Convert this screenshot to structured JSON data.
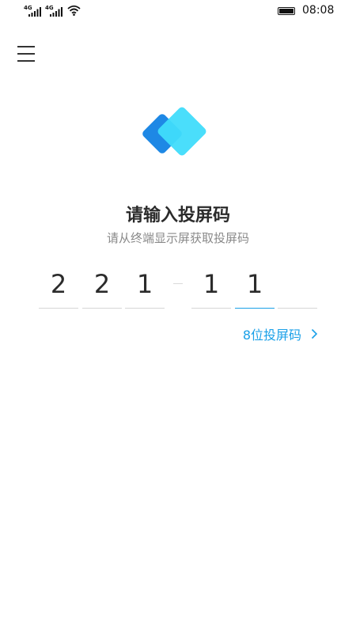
{
  "status_bar": {
    "net1": "4G",
    "net2": "4G",
    "time": "08:08"
  },
  "screen": {
    "title": "请输入投屏码",
    "subtitle": "请从终端显示屏获取投屏码",
    "code_digits": [
      "2",
      "2",
      "1",
      "1",
      "1",
      ""
    ],
    "alt_code_link": "8位投屏码"
  },
  "colors": {
    "accent": "#1aa0e8",
    "logo_dark": "#1e88e5",
    "logo_light": "#40dcfb"
  },
  "icons": {
    "menu": "hamburger-menu-icon",
    "logo": "screen-cast-logo-icon",
    "chevron": "chevron-right-icon"
  }
}
